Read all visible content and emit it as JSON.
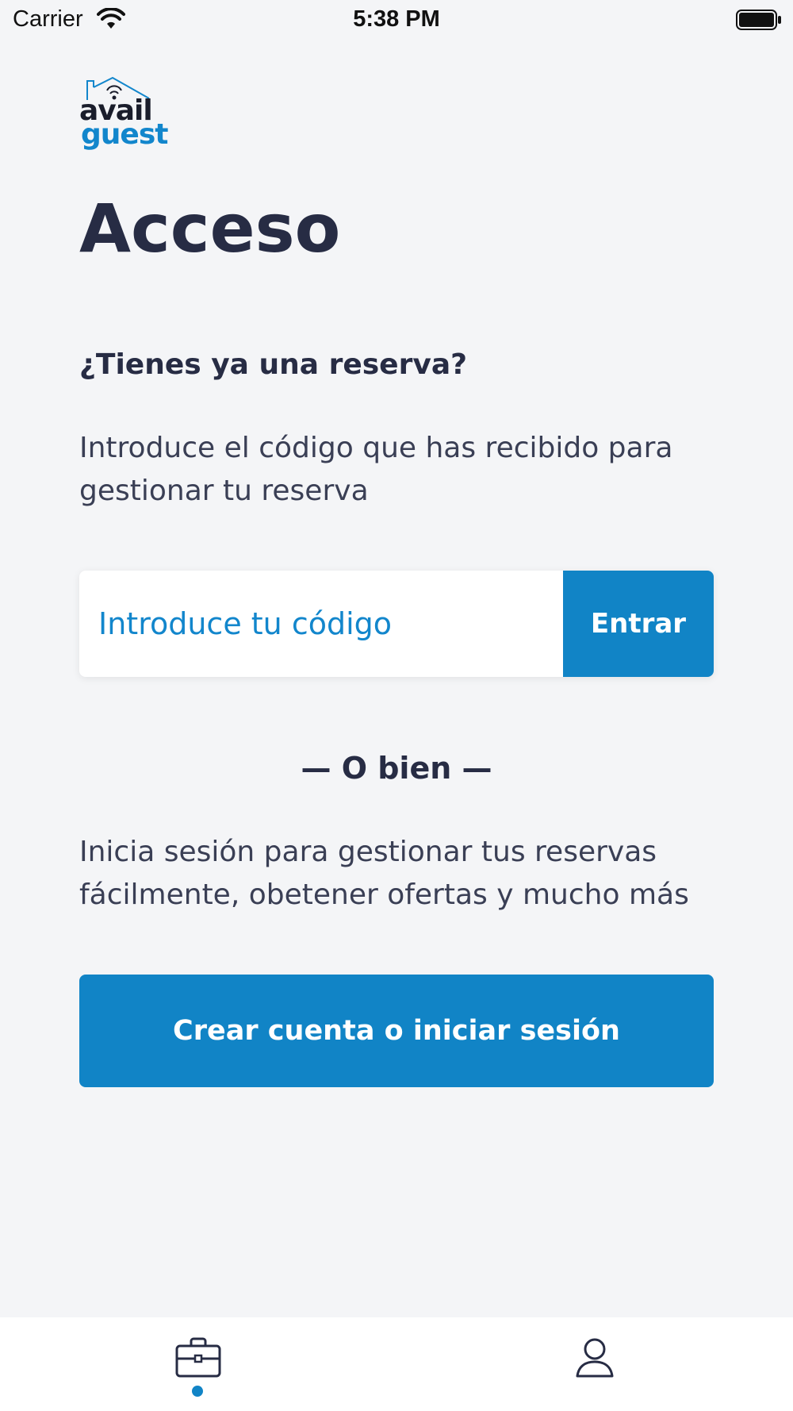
{
  "status_bar": {
    "carrier": "Carrier",
    "time": "5:38 PM",
    "icons": [
      "wifi-icon",
      "battery-icon"
    ]
  },
  "logo": {
    "line1": "avail",
    "line2": "guest",
    "icon": "house-roof-wifi-icon"
  },
  "page": {
    "title": "Acceso"
  },
  "reservation": {
    "heading": "¿Tienes ya una reserva?",
    "description": "Introduce el código que has recibido para gestionar tu reserva",
    "code_placeholder": "Introduce tu código",
    "enter_label": "Entrar"
  },
  "divider": {
    "label": "— O bien —"
  },
  "login": {
    "description": "Inicia sesión para gestionar tus reservas fácilmente, obetener ofertas y mucho más",
    "button_label": "Crear cuenta o iniciar sesión"
  },
  "tab_bar": {
    "items": [
      {
        "icon": "briefcase-icon",
        "active": true
      },
      {
        "icon": "user-icon",
        "active": false
      }
    ]
  },
  "colors": {
    "accent": "#1184c6",
    "background": "#f4f5f7",
    "text": "#272c44"
  }
}
